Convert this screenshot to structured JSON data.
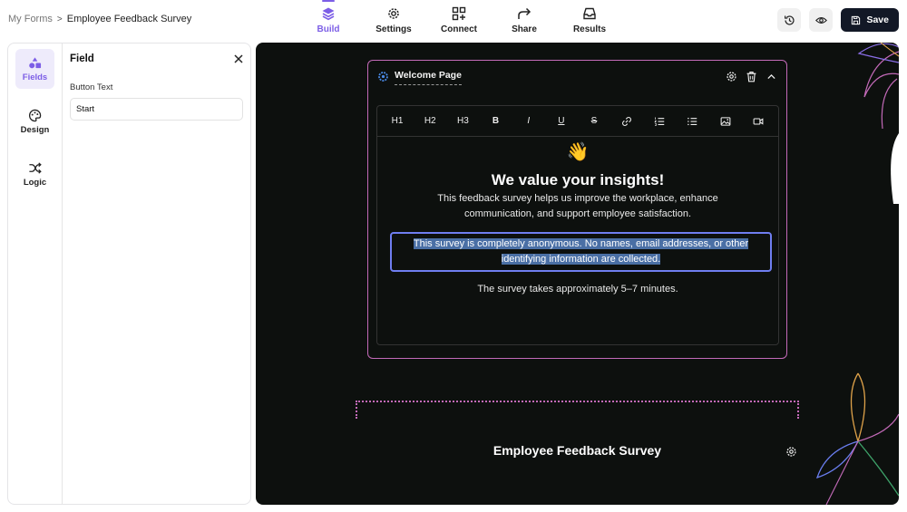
{
  "breadcrumb": {
    "parent": "My Forms",
    "separator": ">",
    "current": "Employee Feedback Survey"
  },
  "nav": [
    {
      "label": "Build",
      "icon": "layers-icon",
      "active": true
    },
    {
      "label": "Settings",
      "icon": "gear-icon"
    },
    {
      "label": "Connect",
      "icon": "grid-plus-icon"
    },
    {
      "label": "Share",
      "icon": "share-arrow-icon"
    },
    {
      "label": "Results",
      "icon": "inbox-icon"
    }
  ],
  "actions": {
    "history_icon": "history-icon",
    "preview_icon": "eye-icon",
    "save_label": "Save"
  },
  "sidebar": {
    "rail": [
      {
        "label": "Fields",
        "icon": "shapes-icon",
        "active": true
      },
      {
        "label": "Design",
        "icon": "palette-icon"
      },
      {
        "label": "Logic",
        "icon": "shuffle-icon"
      }
    ],
    "panel": {
      "title": "Field",
      "button_text_label": "Button Text",
      "button_text_value": "Start"
    }
  },
  "welcome_card": {
    "title": "Welcome Page",
    "toolbar": [
      "H1",
      "H2",
      "H3",
      "B",
      "I",
      "U",
      "S",
      "link",
      "ordered-list",
      "bullet-list",
      "image",
      "video"
    ],
    "emoji": "👋",
    "heading": "We value your insights!",
    "paragraph1": "This feedback survey helps us improve the workplace, enhance communication, and support employee satisfaction.",
    "paragraph2_line1": "This survey is completely anonymous. No names, email addresses, or other",
    "paragraph2_line2": "identifying information are collected.",
    "paragraph3": "The survey takes approximately 5–7 minutes."
  },
  "form_title": "Employee Feedback Survey",
  "colors": {
    "accent": "#7c5ee6",
    "canvas_bg": "#0d100e",
    "card_border": "#c36ab8",
    "selection": "#4a6fa5"
  }
}
